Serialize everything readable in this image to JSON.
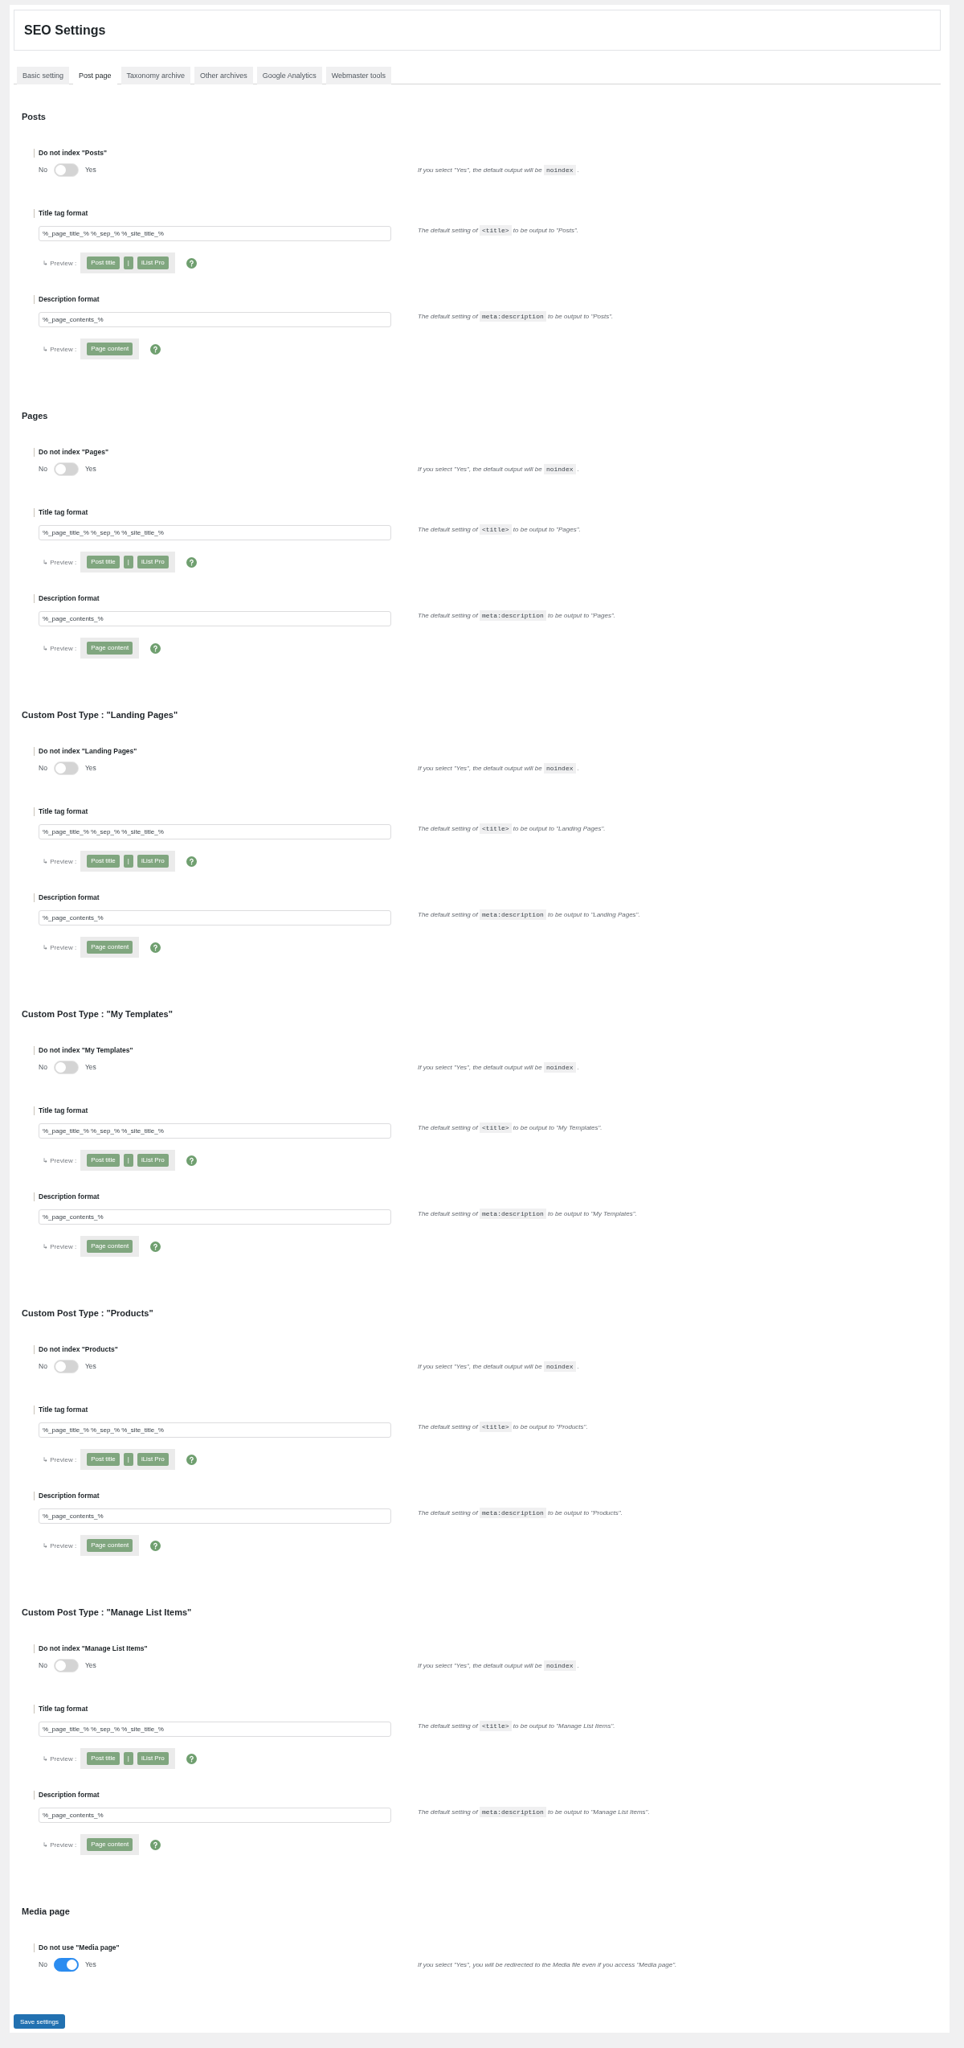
{
  "header": {
    "title": "SEO Settings"
  },
  "tabs": [
    {
      "label": "Basic setting",
      "selected": false
    },
    {
      "label": "Post page",
      "selected": true
    },
    {
      "label": "Taxonomy archive",
      "selected": false
    },
    {
      "label": "Other archives",
      "selected": false
    },
    {
      "label": "Google Analytics",
      "selected": false
    },
    {
      "label": "Webmaster tools",
      "selected": false
    }
  ],
  "sections": [
    {
      "heading": "Posts",
      "fields": [
        {
          "kind": "toggle",
          "label": "Do not index \"Posts\"",
          "off_label": "No",
          "on_label": "Yes",
          "on": false,
          "description": {
            "text": "If you select \"Yes\", the default output will be",
            "code": "noindex",
            "after": "."
          }
        },
        {
          "kind": "text",
          "label": "Title tag format",
          "value": "%_page_title_% %_sep_% %_site_title_%",
          "preview_label": "↳ Preview :",
          "preview": [
            "Post title",
            "|",
            "iList Pro"
          ],
          "description": {
            "text": "The default setting of",
            "code": "<title>",
            "after": "to be output to \"Posts\"."
          }
        },
        {
          "kind": "text",
          "label": "Description format",
          "value": "%_page_contents_%",
          "preview_label": "↳ Preview :",
          "preview": [
            "Page content"
          ],
          "description": {
            "text": "The default setting of",
            "code": "meta:description",
            "after": "to be output to \"Posts\"."
          }
        }
      ]
    },
    {
      "heading": "Pages",
      "fields": [
        {
          "kind": "toggle",
          "label": "Do not index \"Pages\"",
          "off_label": "No",
          "on_label": "Yes",
          "on": false,
          "description": {
            "text": "If you select \"Yes\", the default output will be",
            "code": "noindex",
            "after": "."
          }
        },
        {
          "kind": "text",
          "label": "Title tag format",
          "value": "%_page_title_% %_sep_% %_site_title_%",
          "preview_label": "↳ Preview :",
          "preview": [
            "Post title",
            "|",
            "iList Pro"
          ],
          "description": {
            "text": "The default setting of",
            "code": "<title>",
            "after": "to be output to \"Pages\"."
          }
        },
        {
          "kind": "text",
          "label": "Description format",
          "value": "%_page_contents_%",
          "preview_label": "↳ Preview :",
          "preview": [
            "Page content"
          ],
          "description": {
            "text": "The default setting of",
            "code": "meta:description",
            "after": "to be output to \"Pages\"."
          }
        }
      ]
    },
    {
      "heading": "Custom Post Type : \"Landing Pages\"",
      "fields": [
        {
          "kind": "toggle",
          "label": "Do not index \"Landing Pages\"",
          "off_label": "No",
          "on_label": "Yes",
          "on": false,
          "description": {
            "text": "If you select \"Yes\", the default output will be",
            "code": "noindex",
            "after": "."
          }
        },
        {
          "kind": "text",
          "label": "Title tag format",
          "value": "%_page_title_% %_sep_% %_site_title_%",
          "preview_label": "↳ Preview :",
          "preview": [
            "Post title",
            "|",
            "iList Pro"
          ],
          "description": {
            "text": "The default setting of",
            "code": "<title>",
            "after": "to be output to \"Landing Pages\"."
          }
        },
        {
          "kind": "text",
          "label": "Description format",
          "value": "%_page_contents_%",
          "preview_label": "↳ Preview :",
          "preview": [
            "Page content"
          ],
          "description": {
            "text": "The default setting of",
            "code": "meta:description",
            "after": "to be output to \"Landing Pages\"."
          }
        }
      ]
    },
    {
      "heading": "Custom Post Type : \"My Templates\"",
      "fields": [
        {
          "kind": "toggle",
          "label": "Do not index \"My Templates\"",
          "off_label": "No",
          "on_label": "Yes",
          "on": false,
          "description": {
            "text": "If you select \"Yes\", the default output will be",
            "code": "noindex",
            "after": "."
          }
        },
        {
          "kind": "text",
          "label": "Title tag format",
          "value": "%_page_title_% %_sep_% %_site_title_%",
          "preview_label": "↳ Preview :",
          "preview": [
            "Post title",
            "|",
            "iList Pro"
          ],
          "description": {
            "text": "The default setting of",
            "code": "<title>",
            "after": "to be output to \"My Templates\"."
          }
        },
        {
          "kind": "text",
          "label": "Description format",
          "value": "%_page_contents_%",
          "preview_label": "↳ Preview :",
          "preview": [
            "Page content"
          ],
          "description": {
            "text": "The default setting of",
            "code": "meta:description",
            "after": "to be output to \"My Templates\"."
          }
        }
      ]
    },
    {
      "heading": "Custom Post Type : \"Products\"",
      "fields": [
        {
          "kind": "toggle",
          "label": "Do not index \"Products\"",
          "off_label": "No",
          "on_label": "Yes",
          "on": false,
          "description": {
            "text": "If you select \"Yes\", the default output will be",
            "code": "noindex",
            "after": "."
          }
        },
        {
          "kind": "text",
          "label": "Title tag format",
          "value": "%_page_title_% %_sep_% %_site_title_%",
          "preview_label": "↳ Preview :",
          "preview": [
            "Post title",
            "|",
            "iList Pro"
          ],
          "description": {
            "text": "The default setting of",
            "code": "<title>",
            "after": "to be output to \"Products\"."
          }
        },
        {
          "kind": "text",
          "label": "Description format",
          "value": "%_page_contents_%",
          "preview_label": "↳ Preview :",
          "preview": [
            "Page content"
          ],
          "description": {
            "text": "The default setting of",
            "code": "meta:description",
            "after": "to be output to \"Products\"."
          }
        }
      ]
    },
    {
      "heading": "Custom Post Type : \"Manage List Items\"",
      "fields": [
        {
          "kind": "toggle",
          "label": "Do not index \"Manage List Items\"",
          "off_label": "No",
          "on_label": "Yes",
          "on": false,
          "description": {
            "text": "If you select \"Yes\", the default output will be",
            "code": "noindex",
            "after": "."
          }
        },
        {
          "kind": "text",
          "label": "Title tag format",
          "value": "%_page_title_% %_sep_% %_site_title_%",
          "preview_label": "↳ Preview :",
          "preview": [
            "Post title",
            "|",
            "iList Pro"
          ],
          "description": {
            "text": "The default setting of",
            "code": "<title>",
            "after": "to be output to \"Manage List Items\"."
          }
        },
        {
          "kind": "text",
          "label": "Description format",
          "value": "%_page_contents_%",
          "preview_label": "↳ Preview :",
          "preview": [
            "Page content"
          ],
          "description": {
            "text": "The default setting of",
            "code": "meta:description",
            "after": "to be output to \"Manage List Items\"."
          }
        }
      ]
    },
    {
      "heading": "Media page",
      "fields": [
        {
          "kind": "toggle",
          "label": "Do not use \"Media page\"",
          "off_label": "No",
          "on_label": "Yes",
          "on": true,
          "description": {
            "text": "If you select \"Yes\", you will be redirected to the Media file even if you access \"Media page\"."
          }
        }
      ]
    }
  ],
  "save_button": "Save settings"
}
